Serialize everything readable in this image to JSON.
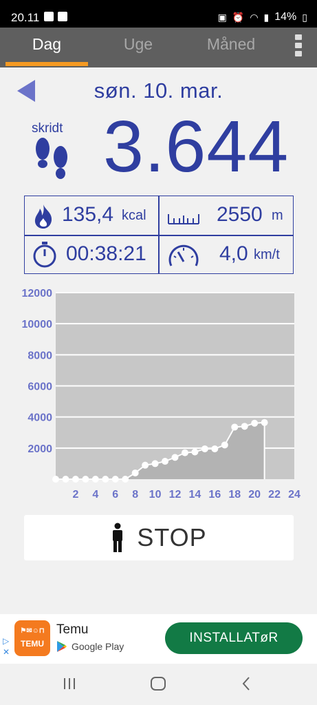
{
  "status": {
    "time": "20.11",
    "battery": "14%"
  },
  "tabs": [
    {
      "label": "Dag",
      "active": true
    },
    {
      "label": "Uge",
      "active": false
    },
    {
      "label": "Måned",
      "active": false
    }
  ],
  "date": "søn. 10. mar.",
  "steps": {
    "label": "skridt",
    "value": "3.644"
  },
  "stats": {
    "calories": {
      "value": "135,4",
      "unit": "kcal",
      "icon": "flame-icon"
    },
    "distance": {
      "value": "2550",
      "unit": "m",
      "icon": "ruler-icon"
    },
    "duration": {
      "value": "00:38:21",
      "icon": "stopwatch-icon"
    },
    "speed": {
      "value": "4,0",
      "unit": "km/t",
      "icon": "speedometer-icon"
    }
  },
  "chart_data": {
    "type": "area",
    "x": [
      0,
      1,
      2,
      3,
      4,
      5,
      6,
      7,
      8,
      9,
      10,
      11,
      12,
      13,
      14,
      15,
      16,
      17,
      18,
      19,
      20,
      21
    ],
    "values": [
      0,
      0,
      0,
      0,
      0,
      0,
      0,
      0,
      400,
      900,
      1000,
      1150,
      1400,
      1700,
      1750,
      1950,
      1950,
      2200,
      3350,
      3400,
      3600,
      3644
    ],
    "xticks": [
      2,
      4,
      6,
      8,
      10,
      12,
      14,
      16,
      18,
      20,
      22,
      24
    ],
    "yticks": [
      2000,
      4000,
      6000,
      8000,
      10000,
      12000
    ],
    "xlim": [
      0,
      24
    ],
    "ylim": [
      0,
      12000
    ],
    "grid": true,
    "colors": {
      "background": "#c7c7c7",
      "area": "#b3b3b3",
      "line": "#ffffff",
      "tick_labels": "#6b73c9"
    }
  },
  "stop_button": {
    "label": "STOP",
    "icon": "person-icon"
  },
  "ad": {
    "app_name": "Temu",
    "store": "Google Play",
    "logo_text": "TEMU",
    "install_label": "INSTALLATøR"
  },
  "colors": {
    "accent": "#f59a23",
    "primary": "#2f3ea0",
    "tabbar": "#5f5f5f"
  }
}
